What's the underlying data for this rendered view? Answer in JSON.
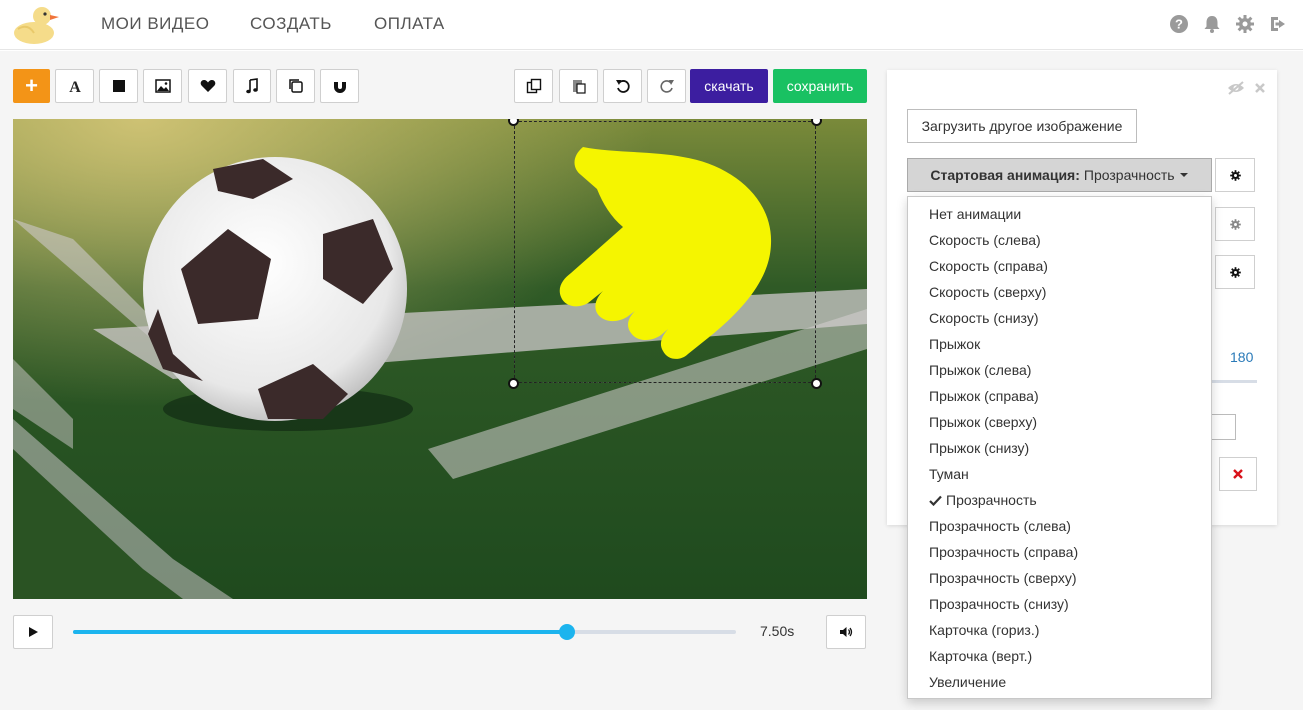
{
  "nav": {
    "items": [
      "МОИ ВИДЕО",
      "СОЗДАТЬ",
      "ОПЛАТА"
    ]
  },
  "toolbar": {
    "download_label": "скачать",
    "save_label": "сохранить",
    "add_label": "+"
  },
  "player": {
    "time": "7.50s",
    "progress": 0.745
  },
  "panel": {
    "upload_label": "Загрузить другое изображение",
    "anim_label": "Стартовая анимация:",
    "anim_value": "Прозрачность",
    "value_180": "180"
  },
  "dropdown": {
    "items": [
      "Нет анимации",
      "Скорость (слева)",
      "Скорость (справа)",
      "Скорость (сверху)",
      "Скорость (снизу)",
      "Прыжок",
      "Прыжок (слева)",
      "Прыжок (справа)",
      "Прыжок (сверху)",
      "Прыжок (снизу)",
      "Туман",
      "Прозрачность",
      "Прозрачность (слева)",
      "Прозрачность (справа)",
      "Прозрачность (сверху)",
      "Прозрачность (снизу)",
      "Карточка (гориз.)",
      "Карточка (верт.)",
      "Увеличение"
    ],
    "selected": "Прозрачность"
  },
  "colors": {
    "accent_orange": "#f39417",
    "download": "#3c1ea0",
    "save": "#19c162",
    "track": "#1cb4ee",
    "hand": "#f5f500"
  }
}
